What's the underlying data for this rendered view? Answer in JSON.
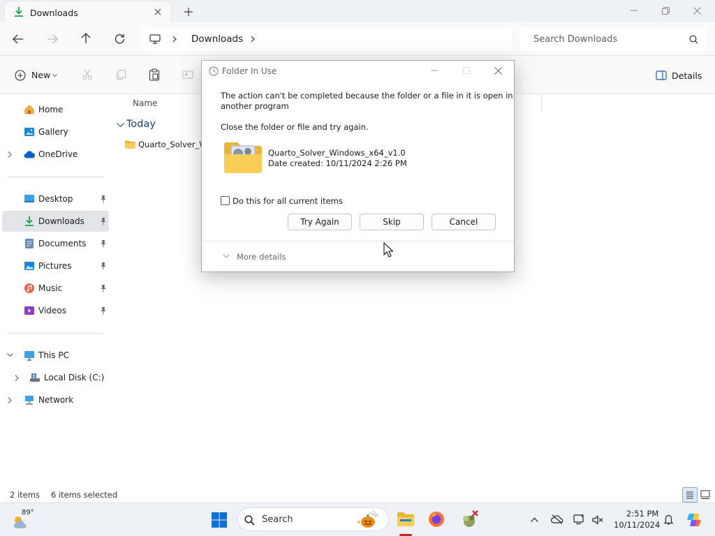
{
  "window": {
    "tab_title": "Downloads",
    "new_tab_symbol": "+",
    "controls": [
      "minimize",
      "maximize",
      "close"
    ]
  },
  "address": {
    "location": "Downloads",
    "search_placeholder": "Search Downloads"
  },
  "commandbar": {
    "new_label": "New",
    "details_label": "Details"
  },
  "nav": {
    "home": "Home",
    "gallery": "Gallery",
    "onedrive": "OneDrive",
    "desktop": "Desktop",
    "downloads": "Downloads",
    "documents": "Documents",
    "pictures": "Pictures",
    "music": "Music",
    "videos": "Videos",
    "thispc": "This PC",
    "localdisk": "Local Disk (C:)",
    "network": "Network"
  },
  "content": {
    "column_name": "Name",
    "group_today": "Today",
    "file_partial": "Quarto_Solver_W"
  },
  "status": {
    "item_count": "2 items",
    "selected": "6 items selected"
  },
  "dialog": {
    "title": "Folder In Use",
    "message_line1": "The action can't be completed because the folder or a file in it is open in",
    "message_line2": "another program",
    "instruction": "Close the folder or file and try again.",
    "item_name": "Quarto_Solver_Windows_x64_v1.0",
    "item_date": "Date created: 10/11/2024 2:26 PM",
    "checkbox_label": "Do this for all current items",
    "checkbox_checked": false,
    "btn_try_again": "Try Again",
    "btn_skip": "Skip",
    "btn_cancel": "Cancel",
    "more_details": "More details"
  },
  "taskbar": {
    "weather_temp": "89°",
    "search_label": "Search",
    "time": "2:51 PM",
    "date": "10/11/2024"
  },
  "colors": {
    "accent": "#0067c0",
    "folder_yellow": "#f5c342",
    "downloads_green": "#1a9e4b"
  }
}
